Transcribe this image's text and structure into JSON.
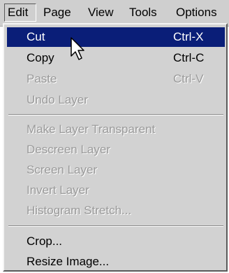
{
  "menubar": {
    "items": [
      "Edit",
      "Page",
      "View",
      "Tools",
      "Options"
    ]
  },
  "edit_menu": {
    "group1": [
      {
        "label": "Cut",
        "shortcut": "Ctrl-X",
        "state": "selected"
      },
      {
        "label": "Copy",
        "shortcut": "Ctrl-C",
        "state": "enabled"
      },
      {
        "label": "Paste",
        "shortcut": "Ctrl-V",
        "state": "disabled"
      },
      {
        "label": "Undo Layer",
        "shortcut": "",
        "state": "disabled"
      }
    ],
    "group2": [
      {
        "label": "Make Layer Transparent",
        "state": "disabled"
      },
      {
        "label": "Descreen Layer",
        "state": "disabled"
      },
      {
        "label": "Screen Layer",
        "state": "disabled"
      },
      {
        "label": "Invert Layer",
        "state": "disabled"
      },
      {
        "label": "Histogram Stretch...",
        "state": "disabled"
      }
    ],
    "group3": [
      {
        "label": "Crop...",
        "state": "enabled"
      },
      {
        "label": "Resize Image...",
        "state": "enabled"
      }
    ]
  },
  "colors": {
    "highlight": "#0a1e78",
    "menu_bg": "#d2d2d2",
    "disabled_text": "#9a9a9a"
  },
  "icons": {
    "cursor": "mouse-pointer-icon"
  }
}
